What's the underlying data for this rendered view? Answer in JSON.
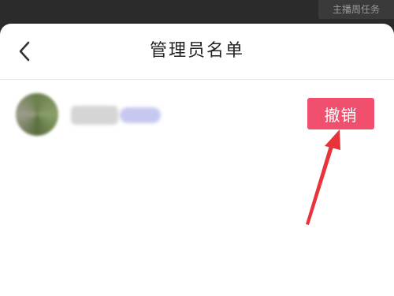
{
  "status_bar": {
    "badge_text": "主播周任务"
  },
  "header": {
    "title": "管理员名单",
    "back_icon": "chevron-left-icon"
  },
  "admin_list": [
    {
      "avatar_icon": "blurred-avatar",
      "action_label": "撤销"
    }
  ],
  "colors": {
    "accent": "#f0506e",
    "annotation_arrow": "#e8333b"
  }
}
